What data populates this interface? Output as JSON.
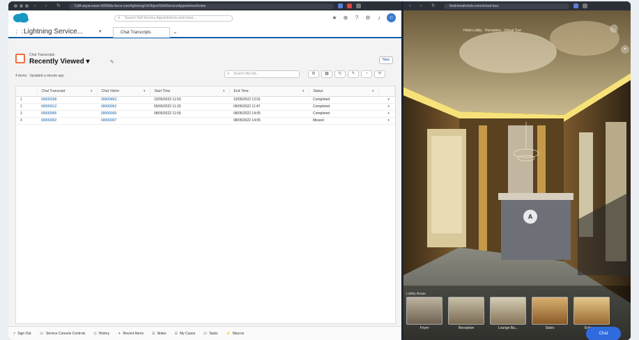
{
  "left_browser": {
    "url": "CdA-aqua-wave-4283bfa-force.com/lightning/r/sObject/ShiftServiceAppointment/view",
    "salesforce": {
      "search_placeholder": "Search Self-Service Appointments and more...",
      "app_name": "Lightning Service...",
      "tab_label": "Chat Transcripts",
      "object_label": "Chat Transcripts",
      "view_name": "Recently Viewed",
      "meta": "4 items · Updated a minute ago",
      "new_button": "New",
      "list_search_placeholder": "Search this list...",
      "columns": [
        "Chat Transcript",
        "Chat Visitor",
        "Start Time",
        "End Time",
        "Status"
      ],
      "rows": [
        {
          "num": "1",
          "transcript": "00000268",
          "visitor": "00000463",
          "start": "10/05/2022 11:53",
          "end": "10/05/2022 12:01",
          "status": "Completed"
        },
        {
          "num": "2",
          "transcript": "00000012",
          "visitor": "00000062",
          "start": "09/05/2022 11:33",
          "end": "09/05/2022 11:47",
          "status": "Completed"
        },
        {
          "num": "3",
          "transcript": "00000005",
          "visitor": "00000006",
          "start": "08/05/2022 11:59",
          "end": "08/05/2022 14:05",
          "status": "Completed"
        },
        {
          "num": "4",
          "transcript": "00000002",
          "visitor": "00000007",
          "start": "",
          "end": "08/05/2022 14:05",
          "status": "Missed"
        }
      ],
      "footer": [
        {
          "icon": "rocket-icon",
          "label": "Sign Out"
        },
        {
          "icon": "phone-icon",
          "label": "Service Console Controls"
        },
        {
          "icon": "history-icon",
          "label": "History"
        },
        {
          "icon": "list-icon",
          "label": "Recent Items"
        },
        {
          "icon": "note-icon",
          "label": "Notes"
        },
        {
          "icon": "list-icon",
          "label": "My Cases"
        },
        {
          "icon": "list-icon",
          "label": "Tasks"
        },
        {
          "icon": "list-icon",
          "label": "Macros"
        }
      ]
    }
  },
  "right_browser": {
    "url": "theliminalhotels.com/virtual-tour",
    "tour_title": "Hotel Lobby · Reception · Virtual Tour",
    "nav_marker": "A",
    "thumbs_label": "Lobby Areas",
    "thumbs": [
      "Foyer",
      "Reception",
      "Lounge Ba...",
      "Stairs",
      "Entrance"
    ],
    "chat_button": "Chat"
  },
  "colors": {
    "salesforce_blue": "#0b5cab",
    "object_icon": "#f26b3a",
    "chat_button": "#2f6bdc"
  }
}
